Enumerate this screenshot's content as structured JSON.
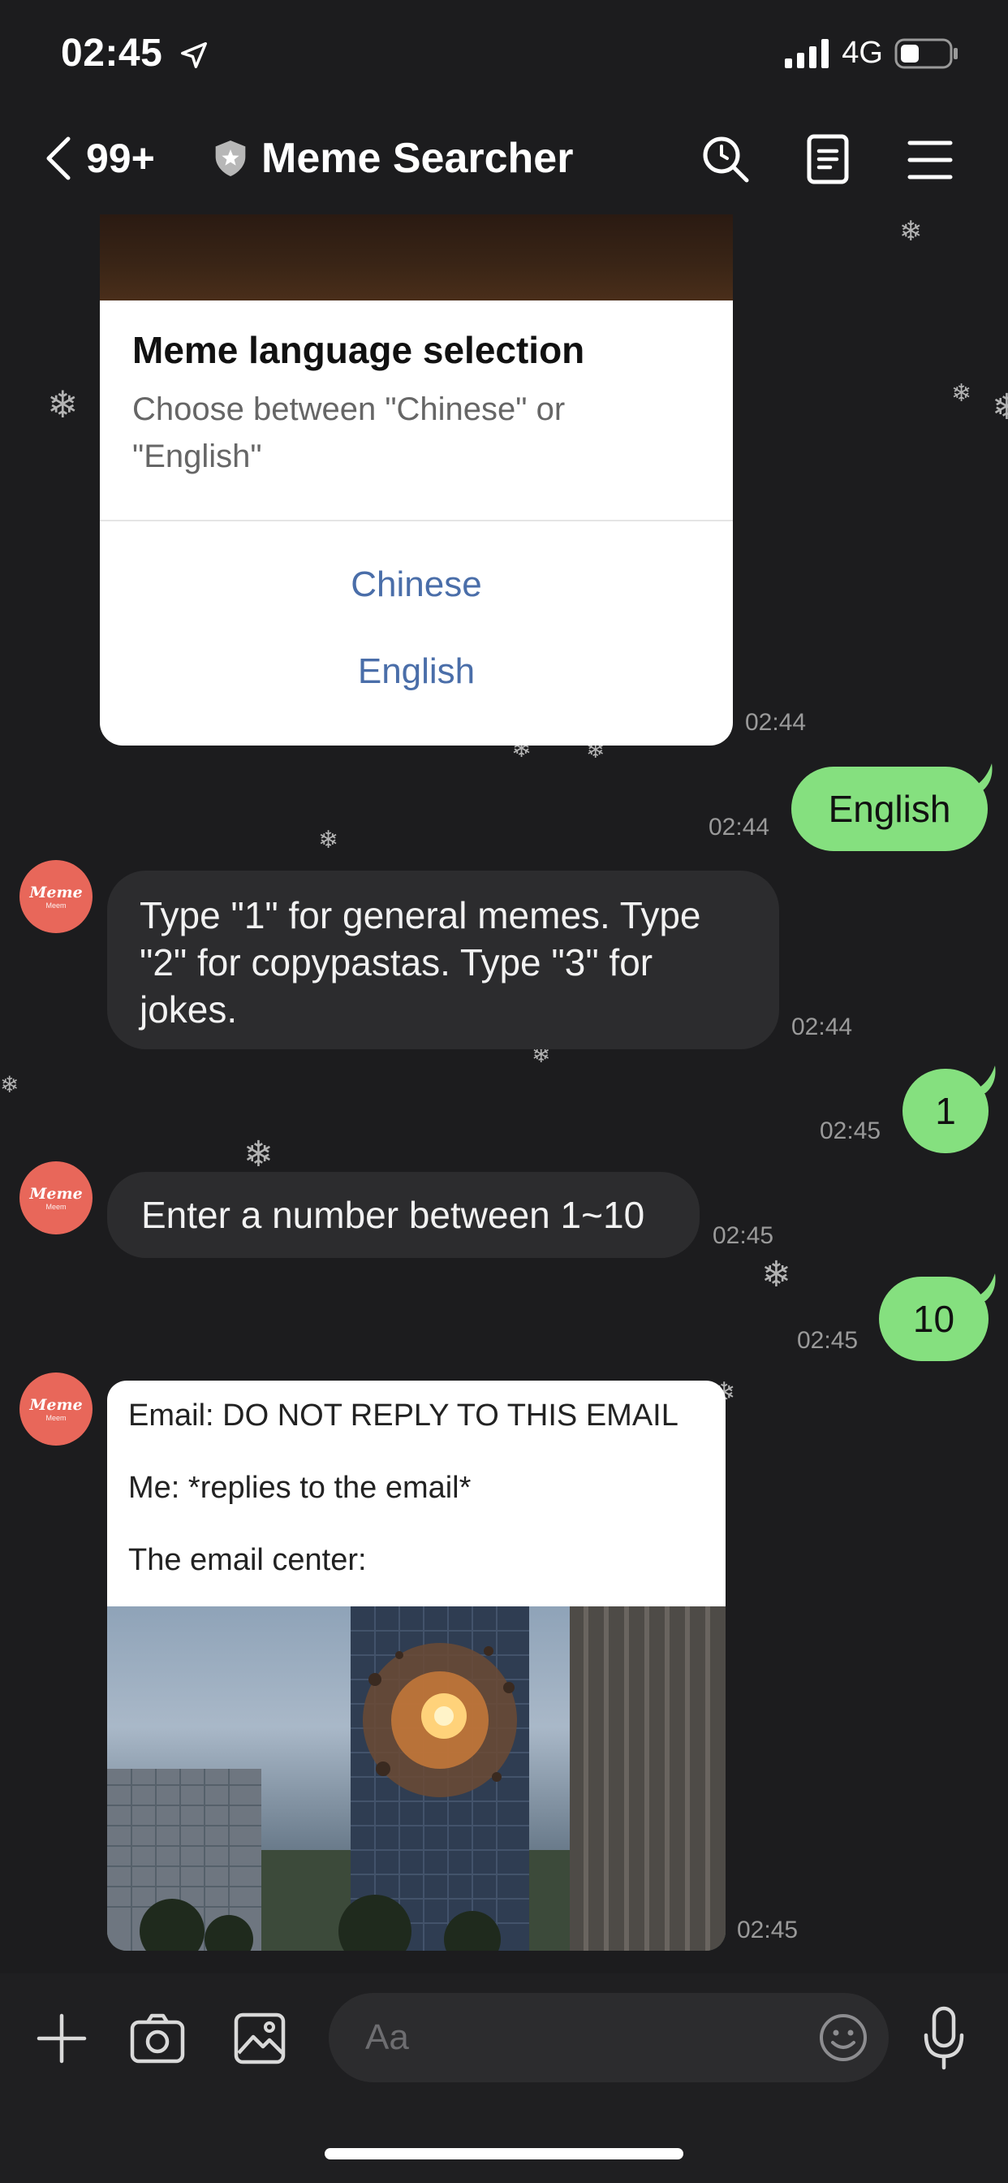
{
  "status": {
    "time": "02:45",
    "network": "4G"
  },
  "header": {
    "unread_count": "99+",
    "title": "Meme Searcher"
  },
  "card": {
    "title": "Meme language selection",
    "description": "Choose between \"Chinese\" or \"English\"",
    "options": [
      "Chinese",
      "English"
    ],
    "time": "02:44"
  },
  "messages": [
    {
      "from": "me",
      "text": "English",
      "time": "02:44"
    },
    {
      "from": "bot",
      "text": "Type \"1\" for general memes. Type \"2\" for copypastas. Type \"3\" for jokes.",
      "time": "02:44"
    },
    {
      "from": "me",
      "text": "1",
      "time": "02:45"
    },
    {
      "from": "bot",
      "text": "Enter a number between 1~10",
      "time": "02:45"
    },
    {
      "from": "me",
      "text": "10",
      "time": "02:45"
    }
  ],
  "meme": {
    "lines": [
      "Email: DO NOT REPLY TO THIS EMAIL",
      "Me: *replies to the email*",
      "The email center:"
    ],
    "time": "02:45"
  },
  "avatar": {
    "main": "Meme",
    "sub": "Meem"
  },
  "input": {
    "placeholder": "Aa"
  },
  "colors": {
    "accent_green": "#85e07f",
    "link_blue": "#4a6ea9",
    "avatar_red": "#e8675a"
  }
}
